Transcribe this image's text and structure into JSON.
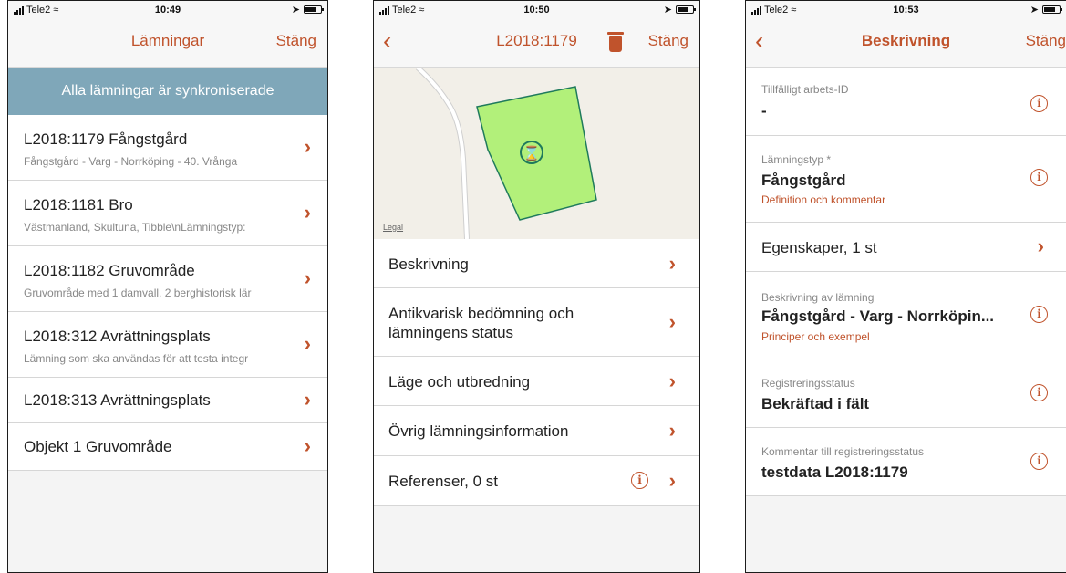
{
  "screen1": {
    "status": {
      "carrier": "Tele2",
      "time": "10:49"
    },
    "nav": {
      "title": "Lämningar",
      "close": "Stäng"
    },
    "sync_text": "Alla lämningar är synkroniserade",
    "items": [
      {
        "title": "L2018:1179 Fångstgård",
        "subtitle": "Fångstgård - Varg - Norrköping - 40. Vrånga"
      },
      {
        "title": "L2018:1181 Bro",
        "subtitle": "Västmanland, Skultuna, Tibble\\nLämningstyp:"
      },
      {
        "title": "L2018:1182 Gruvområde",
        "subtitle": "Gruvområde med 1 damvall, 2 berghistorisk lär"
      },
      {
        "title": "L2018:312 Avrättningsplats",
        "subtitle": "Lämning som ska användas för att testa integr"
      },
      {
        "title": "L2018:313 Avrättningsplats"
      },
      {
        "title": "Objekt 1 Gruvområde"
      }
    ]
  },
  "screen2": {
    "status": {
      "carrier": "Tele2",
      "time": "10:50"
    },
    "nav": {
      "title": "L2018:1179",
      "close": "Stäng"
    },
    "map": {
      "legal": "Legal",
      "polygon_color": "#b2f07a",
      "border_color": "#1f7a5c"
    },
    "menu": [
      {
        "label": "Beskrivning"
      },
      {
        "label": "Antikvarisk bedömning och",
        "label2": "lämningens status"
      },
      {
        "label": "Läge och utbredning"
      },
      {
        "label": "Övrig lämningsinformation"
      },
      {
        "label": "Referenser, 0 st"
      }
    ]
  },
  "screen3": {
    "status": {
      "carrier": "Tele2",
      "time": "10:53"
    },
    "nav": {
      "title": "Beskrivning",
      "close": "Stäng"
    },
    "fields": [
      {
        "label": "Tillfälligt arbets-ID",
        "value": "-"
      },
      {
        "label": "Lämningstyp *",
        "value": "Fångstgård",
        "link": "Definition och kommentar"
      },
      {
        "value": "Egenskaper, 1 st"
      },
      {
        "label": "Beskrivning av lämning",
        "value": "Fångstgård - Varg - Norrköpin...",
        "link": "Principer och exempel"
      },
      {
        "label": "Registreringsstatus",
        "value": "Bekräftad i fält"
      },
      {
        "label": "Kommentar till registreringsstatus",
        "value": "testdata L2018:1179"
      }
    ]
  },
  "colors": {
    "accent": "#c0532c",
    "sync_bar": "#7fa7b9"
  }
}
